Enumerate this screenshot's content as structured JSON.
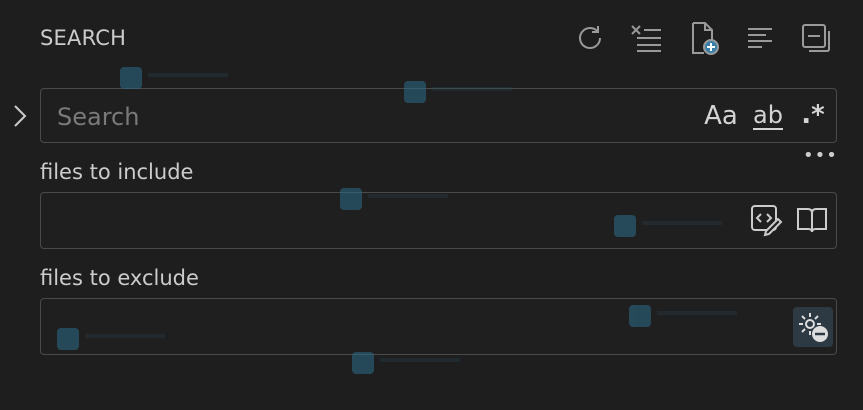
{
  "header": {
    "title": "SEARCH",
    "actions": [
      {
        "name": "refresh-icon"
      },
      {
        "name": "clear-results-icon"
      },
      {
        "name": "new-search-editor-icon"
      },
      {
        "name": "view-as-list-icon"
      },
      {
        "name": "collapse-all-icon"
      }
    ]
  },
  "search": {
    "placeholder": "Search",
    "value": "",
    "match_case_label": "Aa",
    "whole_word_label": "ab",
    "regex_label": ".*"
  },
  "details": {
    "more_label": "•••",
    "include_label": "files to include",
    "include_value": "",
    "exclude_label": "files to exclude",
    "exclude_value": ""
  },
  "colors": {
    "background": "#1e1e1e",
    "border": "#4a4a4a",
    "text": "#cccccc",
    "active_toggle_bg": "#2d3a44"
  }
}
